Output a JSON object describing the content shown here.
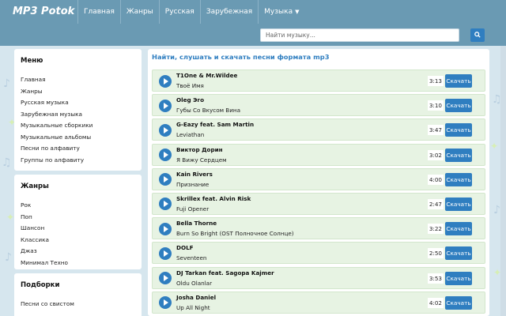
{
  "header": {
    "logo": "MP3 Potok",
    "nav": [
      {
        "label": "Главная"
      },
      {
        "label": "Жанры"
      },
      {
        "label": "Русская"
      },
      {
        "label": "Зарубежная"
      },
      {
        "label": "Музыка",
        "has_dropdown": true
      }
    ],
    "search": {
      "placeholder": "Найти музыку...",
      "value": ""
    }
  },
  "sidebar": {
    "menu": {
      "title": "Меню",
      "items": [
        "Главная",
        "Жанры",
        "Русская музыка",
        "Зарубежная музыка",
        "Музыкальные сборкики",
        "Музыкальные альбомы",
        "Песни по алфавиту",
        "Группы по алфавиту"
      ]
    },
    "genres": {
      "title": "Жанры",
      "items": [
        "Рок",
        "Поп",
        "Шансон",
        "Классика",
        "Джаз",
        "Минимал Техно"
      ]
    },
    "collections": {
      "title": "Подборки",
      "items": [
        "Песни со свистом"
      ]
    }
  },
  "main": {
    "title": "Найти, слушать и скачать песни формата mp3",
    "download_label": "Скачать",
    "tracks": [
      {
        "artist": "T1One & Mr.Wildee",
        "title": "Твоё Имя",
        "duration": "3:13"
      },
      {
        "artist": "Oleg Эго",
        "title": "Губы Со Вкусом Вина",
        "duration": "3:10"
      },
      {
        "artist": "G-Eazy feat. Sam Martin",
        "title": "Leviathan",
        "duration": "3:47"
      },
      {
        "artist": "Виктор Дорин",
        "title": "Я Вижу Сердцем",
        "duration": "3:02"
      },
      {
        "artist": "Kain Rivers",
        "title": "Признание",
        "duration": "4:00"
      },
      {
        "artist": "Skrillex feat. Alvin Risk",
        "title": "Fuji Opener",
        "duration": "2:47"
      },
      {
        "artist": "Bella Thorne",
        "title": "Burn So Bright (OST Полночное Солнце)",
        "duration": "3:22"
      },
      {
        "artist": "DOLF",
        "title": "Seventeen",
        "duration": "2:50"
      },
      {
        "artist": "DJ Tarkan feat. Sagopa Kajmer",
        "title": "Oldu Olanlar",
        "duration": "3:53"
      },
      {
        "artist": "Josha Daniel",
        "title": "Up All Night",
        "duration": "4:02"
      }
    ]
  },
  "colors": {
    "header": "#6a9ab3",
    "accent": "#2f7ec0",
    "track_bg": "#e7f3e3",
    "page_bg": "#d6e6ee"
  }
}
